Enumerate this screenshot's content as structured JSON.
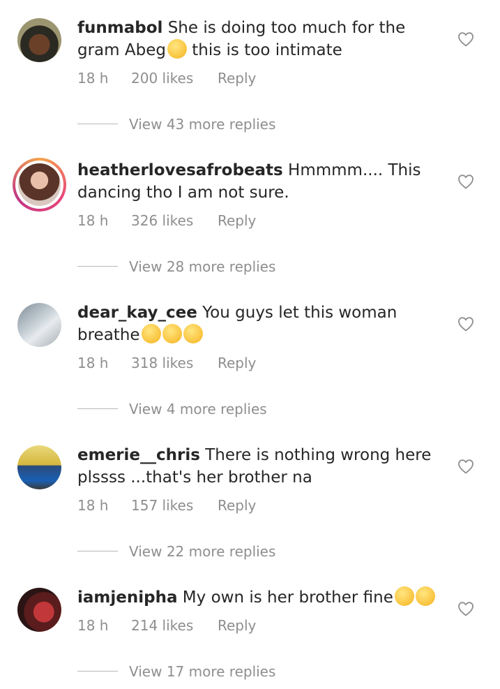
{
  "comments": [
    {
      "username": "funmabol",
      "text_before": "She is doing too much for the gram Abeg",
      "emoji_1": "🥺",
      "text_after": " this is too intimate",
      "time": "18 h",
      "likes": "200 likes",
      "reply": "Reply",
      "view_replies": "View 43 more replies"
    },
    {
      "username": "heatherlovesafrobeats",
      "text_before": "Hmmmm.... This dancing tho I am not sure.",
      "time": "18 h",
      "likes": "326 likes",
      "reply": "Reply",
      "view_replies": "View 28 more replies"
    },
    {
      "username": "dear_kay_cee",
      "text_before": "You guys let this woman breathe",
      "emoji_1": "😂",
      "emoji_2": "😂",
      "emoji_3": "😂",
      "time": "18 h",
      "likes": "318 likes",
      "reply": "Reply",
      "view_replies": "View 4 more replies"
    },
    {
      "username": "emerie__chris",
      "text_before": "There is nothing wrong here plssss ...that's her brother na",
      "time": "18 h",
      "likes": "157 likes",
      "reply": "Reply",
      "view_replies": "View 22 more replies"
    },
    {
      "username": "iamjenipha",
      "text_before": "My own is her brother fine",
      "emoji_1": "🥺",
      "emoji_2": "🥺",
      "time": "18 h",
      "likes": "214 likes",
      "reply": "Reply",
      "view_replies": "View 17 more replies"
    }
  ],
  "icons": {
    "like": "heart-outline-icon"
  },
  "colors": {
    "text": "#262626",
    "muted": "#8e8e8e",
    "story_ring": "#e8457a"
  }
}
